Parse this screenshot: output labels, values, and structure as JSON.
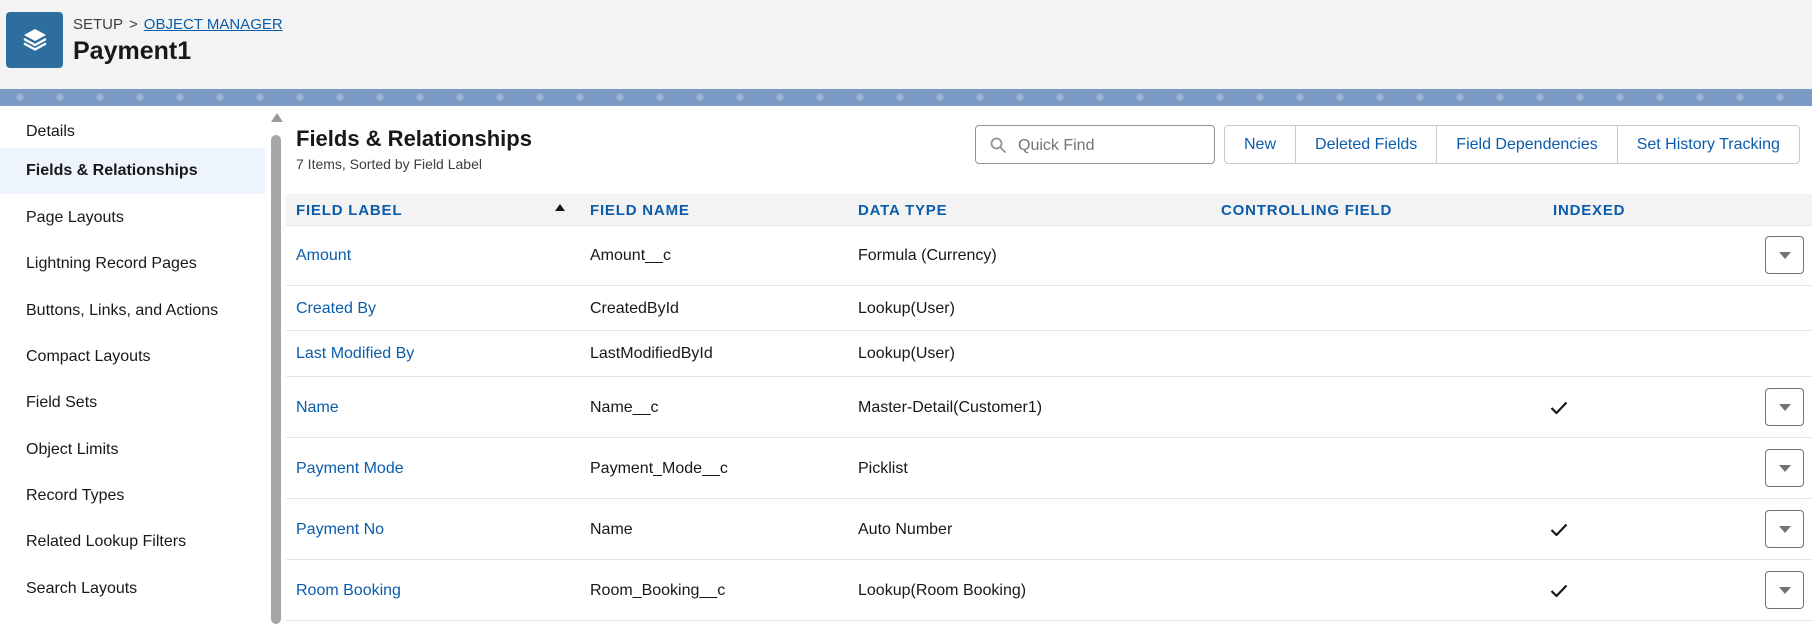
{
  "header": {
    "breadcrumb_root": "SETUP",
    "breadcrumb_sep": ">",
    "breadcrumb_link": "OBJECT MANAGER",
    "title": "Payment1"
  },
  "sidebar": {
    "items": [
      {
        "label": "Details"
      },
      {
        "label": "Fields & Relationships"
      },
      {
        "label": "Page Layouts"
      },
      {
        "label": "Lightning Record Pages"
      },
      {
        "label": "Buttons, Links, and Actions"
      },
      {
        "label": "Compact Layouts"
      },
      {
        "label": "Field Sets"
      },
      {
        "label": "Object Limits"
      },
      {
        "label": "Record Types"
      },
      {
        "label": "Related Lookup Filters"
      },
      {
        "label": "Search Layouts"
      }
    ],
    "active_index": 1
  },
  "section": {
    "title": "Fields & Relationships",
    "subtitle": "7 Items, Sorted by Field Label"
  },
  "search": {
    "placeholder": "Quick Find",
    "value": ""
  },
  "toolbar": {
    "new_label": "New",
    "deleted_fields_label": "Deleted Fields",
    "field_dependencies_label": "Field Dependencies",
    "history_tracking_label": "Set History Tracking"
  },
  "table": {
    "columns": [
      "FIELD LABEL",
      "FIELD NAME",
      "DATA TYPE",
      "CONTROLLING FIELD",
      "INDEXED"
    ],
    "sorted_column": "FIELD LABEL",
    "sort_direction": "ascending",
    "rows": [
      {
        "label": "Amount",
        "name": "Amount__c",
        "type": "Formula (Currency)",
        "controlling": "",
        "indexed": false,
        "has_menu": true
      },
      {
        "label": "Created By",
        "name": "CreatedById",
        "type": "Lookup(User)",
        "controlling": "",
        "indexed": false,
        "has_menu": false
      },
      {
        "label": "Last Modified By",
        "name": "LastModifiedById",
        "type": "Lookup(User)",
        "controlling": "",
        "indexed": false,
        "has_menu": false
      },
      {
        "label": "Name",
        "name": "Name__c",
        "type": "Master-Detail(Customer1)",
        "controlling": "",
        "indexed": true,
        "has_menu": true
      },
      {
        "label": "Payment Mode",
        "name": "Payment_Mode__c",
        "type": "Picklist",
        "controlling": "",
        "indexed": false,
        "has_menu": true
      },
      {
        "label": "Payment No",
        "name": "Name",
        "type": "Auto Number",
        "controlling": "",
        "indexed": true,
        "has_menu": true
      },
      {
        "label": "Room Booking",
        "name": "Room_Booking__c",
        "type": "Lookup(Room Booking)",
        "controlling": "",
        "indexed": true,
        "has_menu": true
      }
    ]
  },
  "icons": {
    "app": "layers-icon",
    "search": "search-icon",
    "sort": "sort-ascending-icon",
    "check": "checkmark-icon",
    "row_menu": "chevron-down-icon"
  },
  "colors": {
    "brand": "#2e6e9e",
    "link": "#0b5cab",
    "active_nav": "#eef4fd",
    "band": "#7b9bc6"
  }
}
